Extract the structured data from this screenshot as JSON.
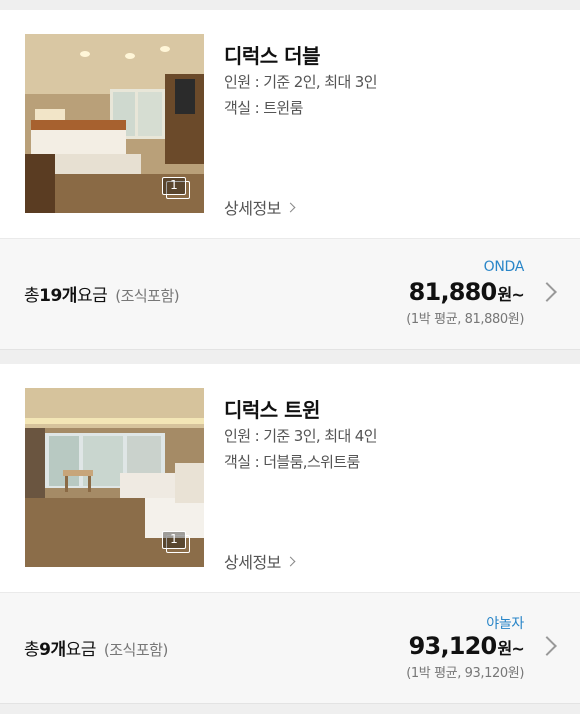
{
  "rooms": [
    {
      "name": "디럭스 더블",
      "capacity": "인원 : 기준 2인, 최대 3인",
      "room_type": "객실 : 트윈룸",
      "photo_count": "1",
      "detail_label": "상세정보",
      "total_prefix": "총 ",
      "total_count": "19개",
      "total_suffix": " 요금",
      "breakfast": "(조식포함)",
      "provider": "ONDA",
      "price": "81,880",
      "price_unit": "원~",
      "avg": "(1박 평균, 81,880원)"
    },
    {
      "name": "디럭스 트윈",
      "capacity": "인원 : 기준 3인, 최대 4인",
      "room_type": "객실 : 더블룸,스위트룸",
      "photo_count": "1",
      "detail_label": "상세정보",
      "total_prefix": "총 ",
      "total_count": "9개",
      "total_suffix": " 요금",
      "breakfast": "(조식포함)",
      "provider": "야놀자",
      "price": "93,120",
      "price_unit": "원~",
      "avg": "(1박 평균, 93,120원)"
    }
  ],
  "colors": {
    "provider": "#2a86c8",
    "price_bg": "#f7f7f7",
    "gap_bg": "#efefef"
  }
}
